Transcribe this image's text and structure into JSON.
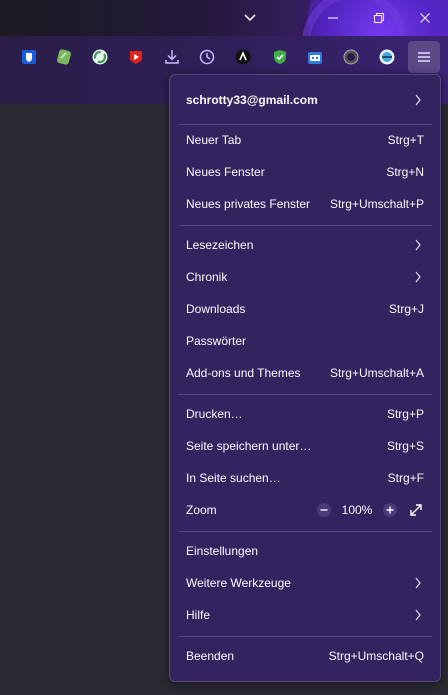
{
  "window": {
    "controls": [
      {
        "name": "tab-list-dropdown",
        "glyph": "⌄"
      },
      {
        "name": "minimize",
        "glyph": "─"
      },
      {
        "name": "restore",
        "glyph": "❐"
      },
      {
        "name": "close",
        "glyph": "✕"
      }
    ]
  },
  "toolbar": {
    "extensions": [
      {
        "name": "bitwarden-icon",
        "color": "#175ddc"
      },
      {
        "name": "notes-extension-icon",
        "color": "#6aa84f"
      },
      {
        "name": "sync-extension-icon",
        "color": "#4caf50"
      },
      {
        "name": "youtube-extension-icon",
        "color": "#e62117"
      },
      {
        "name": "downloads-icon",
        "color": "#c9b8ff"
      },
      {
        "name": "history-clock-icon",
        "color": "#c9b8ff"
      },
      {
        "name": "dark-mode-extension-icon",
        "color": "#111111"
      },
      {
        "name": "shield-extension-icon",
        "color": "#3fae49"
      },
      {
        "name": "robot-extension-icon",
        "color": "#2f7de1"
      },
      {
        "name": "circle-extension-icon",
        "color": "#888888"
      },
      {
        "name": "globe-extension-icon",
        "color": "#4aa3df"
      }
    ],
    "menu_icon": "hamburger-menu-icon"
  },
  "menu": {
    "account": "schrotty33@gmail.com",
    "items": [
      {
        "label": "Neuer Tab",
        "shortcut": "Strg+T"
      },
      {
        "label": "Neues Fenster",
        "shortcut": "Strg+N"
      },
      {
        "label": "Neues privates Fenster",
        "shortcut": "Strg+Umschalt+P"
      },
      {
        "label": "Lesezeichen",
        "shortcut": ""
      },
      {
        "label": "Chronik",
        "shortcut": ""
      },
      {
        "label": "Downloads",
        "shortcut": "Strg+J"
      },
      {
        "label": "Passwörter",
        "shortcut": ""
      },
      {
        "label": "Add-ons und Themes",
        "shortcut": "Strg+Umschalt+A"
      },
      {
        "label": "Drucken…",
        "shortcut": "Strg+P"
      },
      {
        "label": "Seite speichern unter…",
        "shortcut": "Strg+S"
      },
      {
        "label": "In Seite suchen…",
        "shortcut": "Strg+F"
      },
      {
        "label": "Zoom",
        "shortcut": ""
      },
      {
        "label": "Einstellungen",
        "shortcut": ""
      },
      {
        "label": "Weitere Werkzeuge",
        "shortcut": ""
      },
      {
        "label": "Hilfe",
        "shortcut": ""
      },
      {
        "label": "Beenden",
        "shortcut": "Strg+Umschalt+Q"
      }
    ],
    "zoom": {
      "minus": "−",
      "value": "100%",
      "plus": "+"
    }
  },
  "colors": {
    "panel_bg": "#33245f",
    "separator": "#55467f",
    "text": "#fbfbfe",
    "menu_button_active": "#5b4a86"
  }
}
